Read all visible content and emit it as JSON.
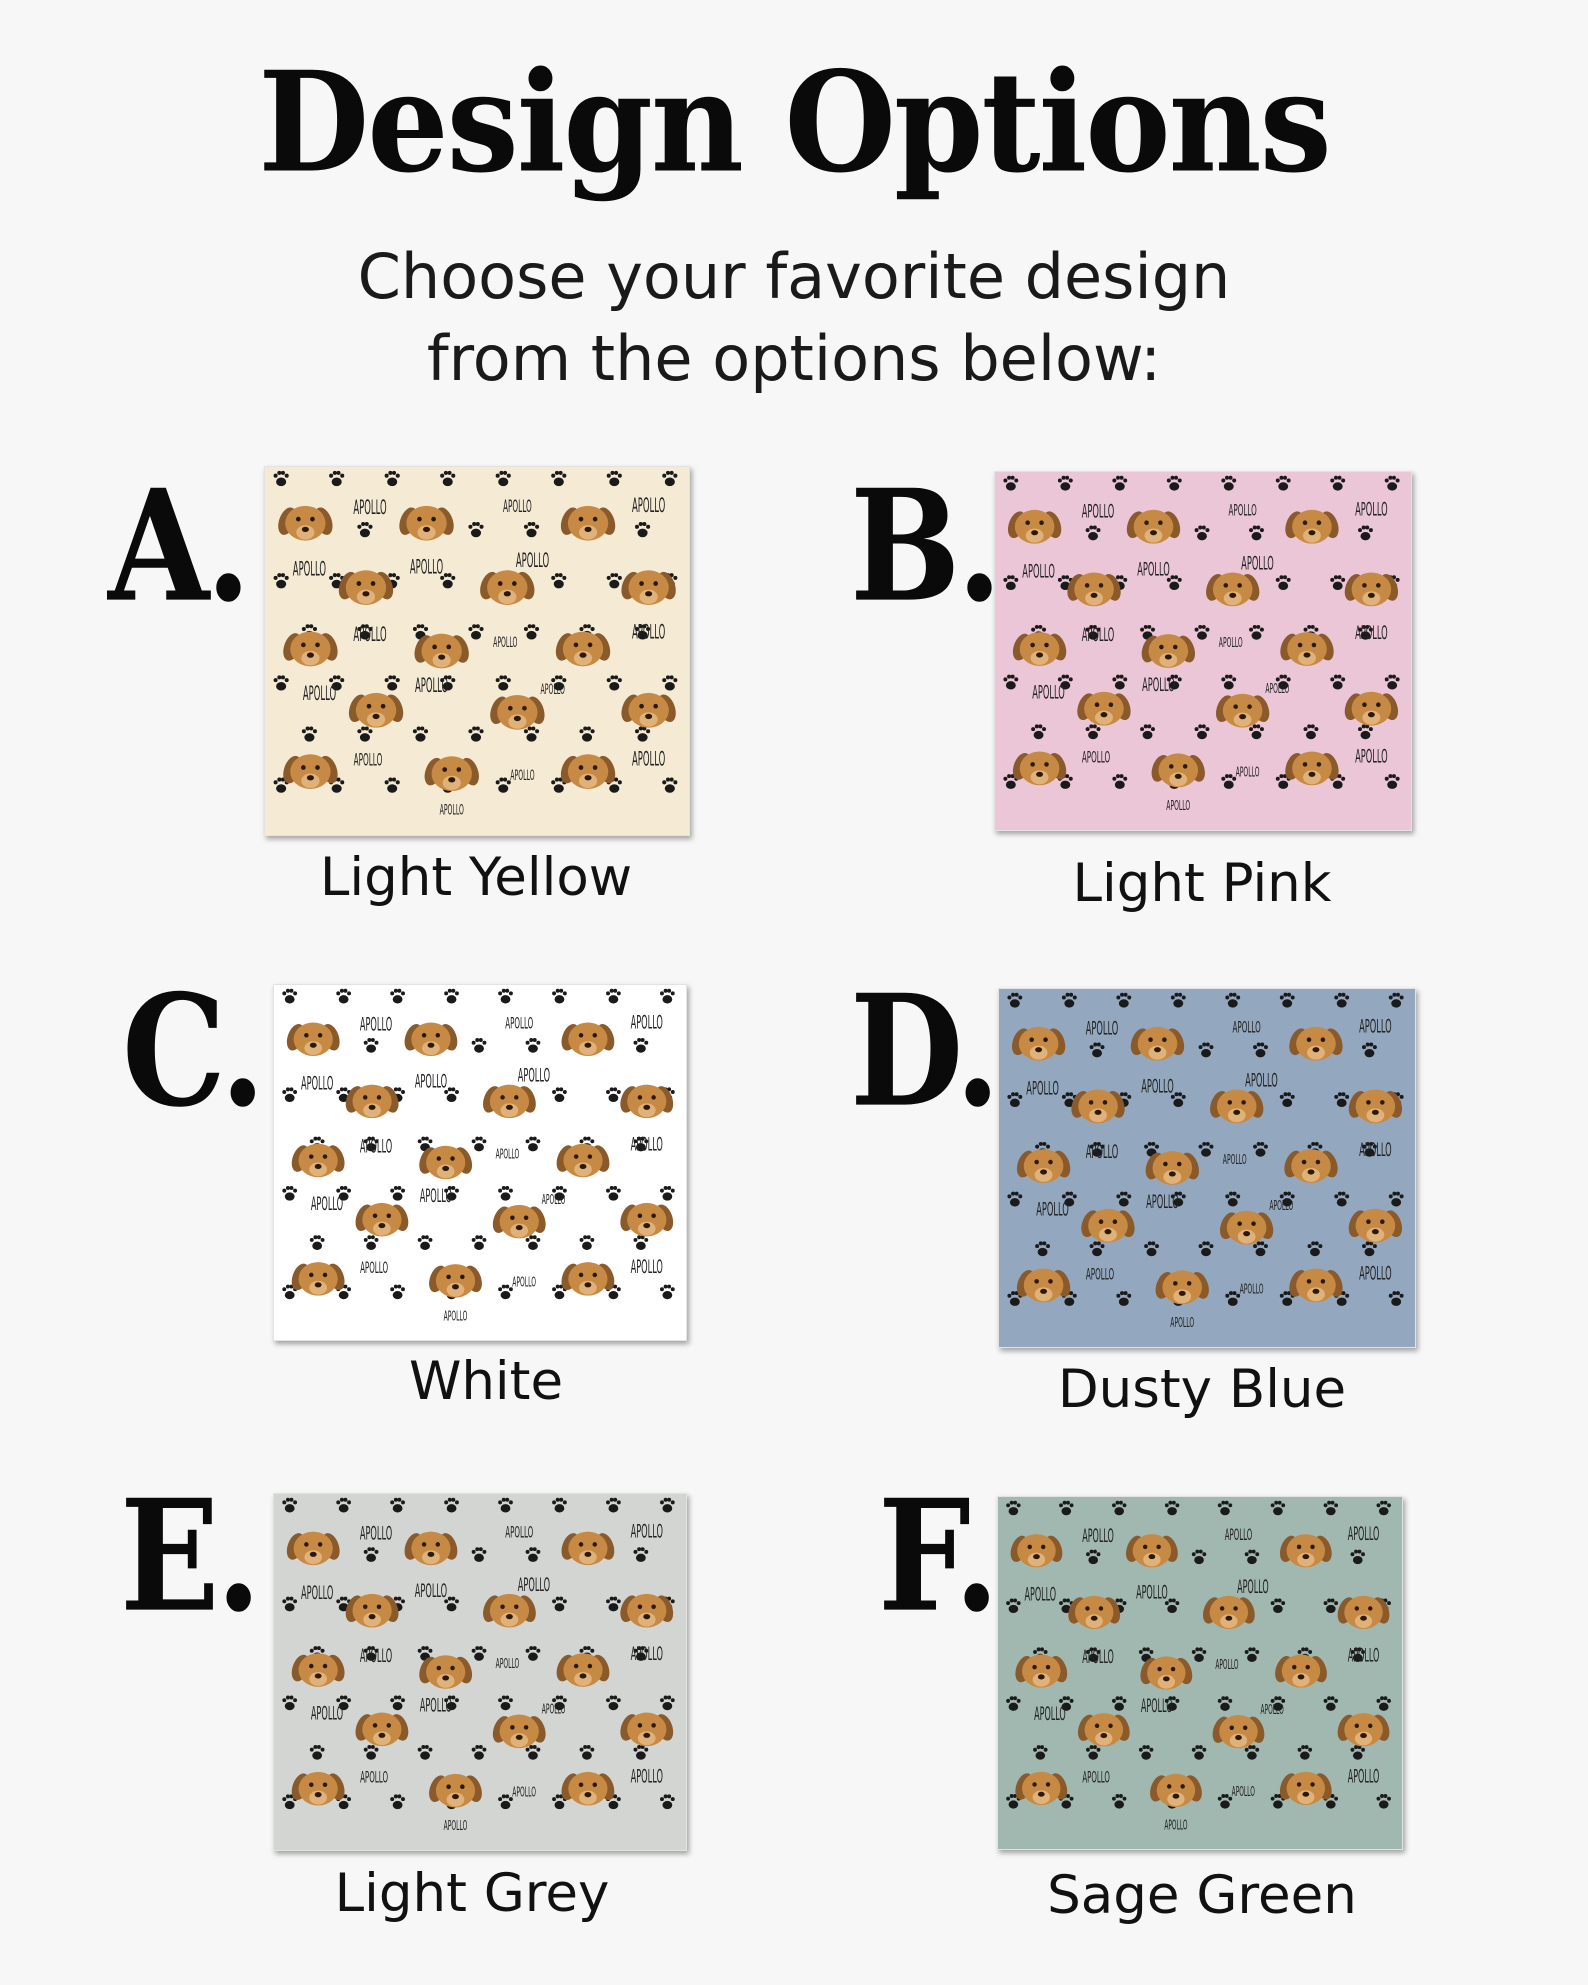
{
  "title": "Design Options",
  "subtitle": {
    "line1": "Choose your favorite design",
    "line2": "from the options below:"
  },
  "pattern_text": "APOLLO",
  "options": [
    {
      "letter": "A.",
      "name": "Light Yellow",
      "color": "#f5ebd5"
    },
    {
      "letter": "B.",
      "name": "Light Pink",
      "color": "#ebc6d6"
    },
    {
      "letter": "C.",
      "name": "White",
      "color": "#ffffff"
    },
    {
      "letter": "D.",
      "name": "Dusty Blue",
      "color": "#93a8bf"
    },
    {
      "letter": "E.",
      "name": "Light Grey",
      "color": "#d3d5d3"
    },
    {
      "letter": "F.",
      "name": "Sage Green",
      "color": "#a1b8b0"
    }
  ],
  "icons": {
    "paw": "paw-print-icon",
    "dog": "dog-face-icon"
  },
  "colors": {
    "paw": "#1a1a1a",
    "dog_fur": "#c68a45",
    "dog_dark": "#8a5a2a"
  }
}
